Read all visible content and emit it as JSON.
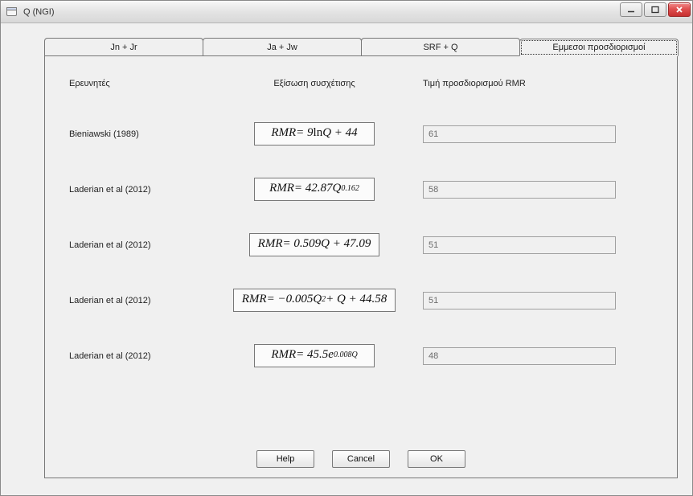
{
  "window": {
    "title": "Q (NGI)"
  },
  "tabs": [
    {
      "label": "Jn + Jr"
    },
    {
      "label": "Ja + Jw"
    },
    {
      "label": "SRF + Q"
    },
    {
      "label": "Εμμεσοι προσδιορισμοί"
    }
  ],
  "activeTabIndex": 3,
  "columns": {
    "researchers": "Ερευνητές",
    "equation": "Εξίσωση συσχέτισης",
    "value": "Τιμή προσδιορισμού RMR"
  },
  "rows": [
    {
      "researcher": "Bieniawski (1989)",
      "equation_html": "<span>RMR</span> = 9<span class='rm'>ln</span>Q + 44",
      "value": "61"
    },
    {
      "researcher": "Laderian et al (2012)",
      "equation_html": "<span>RMR</span> = 42.87Q<sup>0.162</sup>",
      "value": "58"
    },
    {
      "researcher": "Laderian et al  (2012)",
      "equation_html": "<span>RMR</span> = 0.509Q + 47.09",
      "value": "51"
    },
    {
      "researcher": "Laderian et al (2012)",
      "equation_html": "<span>RMR</span> = −0.005Q<sup>2</sup> + Q + 44.58",
      "value": "51"
    },
    {
      "researcher": "Laderian et al  (2012)",
      "equation_html": "<span>RMR</span> = 45.5e<sup>0.008Q</sup>",
      "value": "48"
    }
  ],
  "buttons": {
    "help": "Help",
    "cancel": "Cancel",
    "ok": "OK"
  }
}
